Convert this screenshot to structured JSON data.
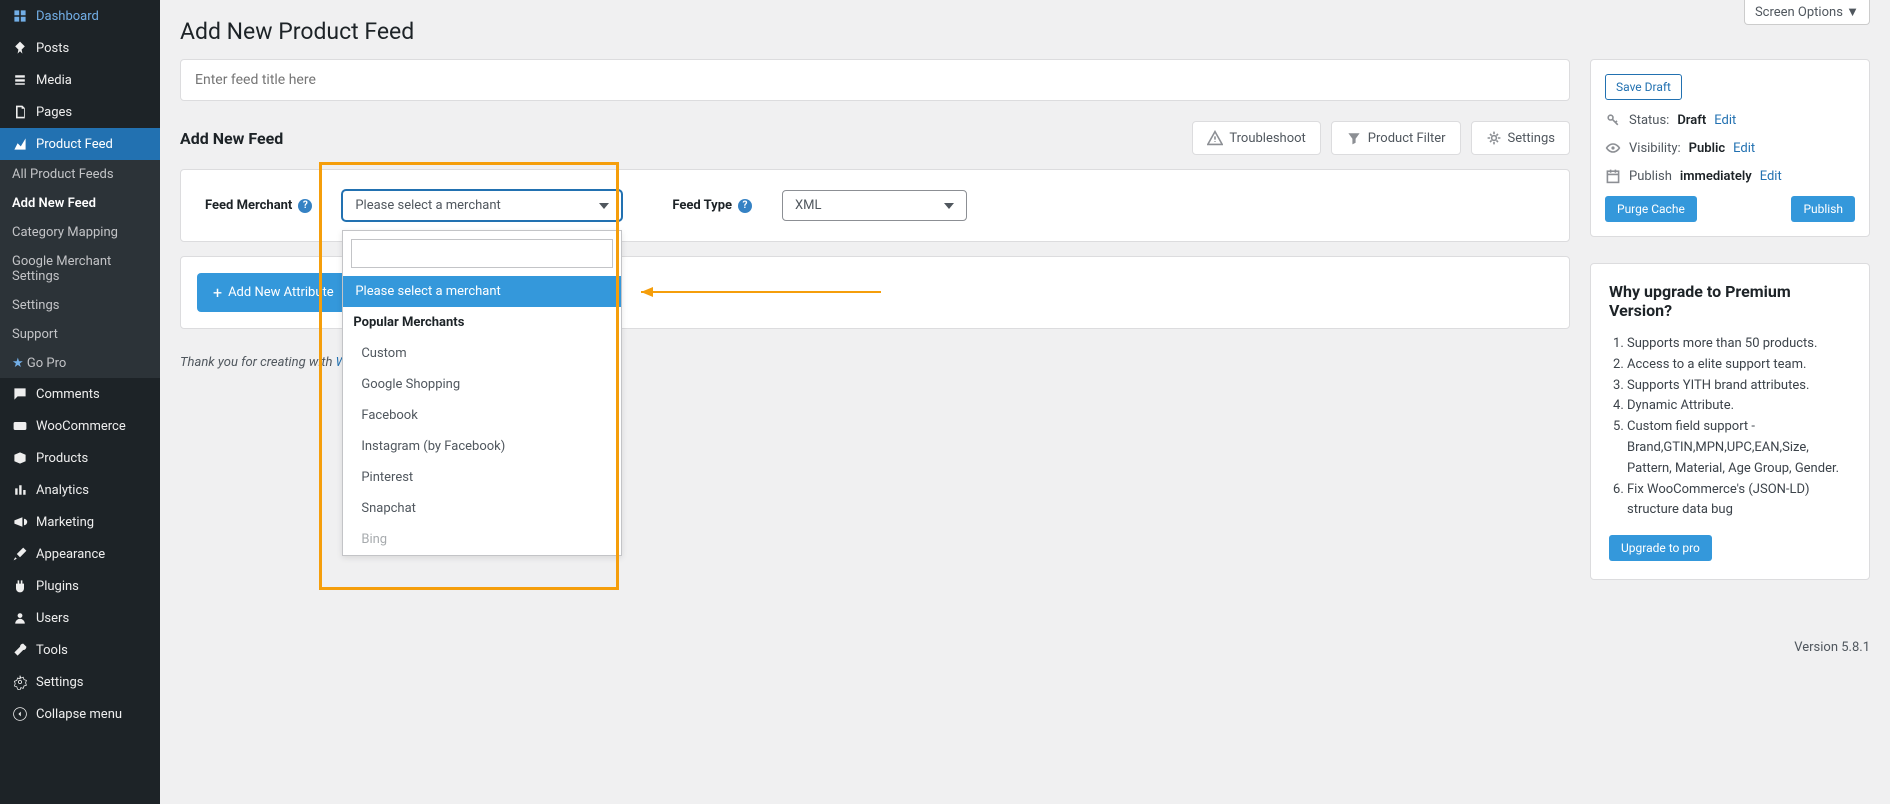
{
  "sidebar": {
    "items": [
      {
        "label": "Dashboard",
        "icon": "dashboard"
      },
      {
        "label": "Posts",
        "icon": "pin"
      },
      {
        "label": "Media",
        "icon": "media"
      },
      {
        "label": "Pages",
        "icon": "pages"
      },
      {
        "label": "Product Feed",
        "icon": "chart"
      },
      {
        "label": "Comments",
        "icon": "comment"
      },
      {
        "label": "WooCommerce",
        "icon": "woo"
      },
      {
        "label": "Products",
        "icon": "box"
      },
      {
        "label": "Analytics",
        "icon": "analytics"
      },
      {
        "label": "Marketing",
        "icon": "megaphone"
      },
      {
        "label": "Appearance",
        "icon": "brush"
      },
      {
        "label": "Plugins",
        "icon": "plug"
      },
      {
        "label": "Users",
        "icon": "users"
      },
      {
        "label": "Tools",
        "icon": "tools"
      },
      {
        "label": "Settings",
        "icon": "settings"
      },
      {
        "label": "Collapse menu",
        "icon": "collapse"
      }
    ],
    "sub_items": [
      "All Product Feeds",
      "Add New Feed",
      "Category Mapping",
      "Google Merchant Settings",
      "Settings",
      "Support",
      "Go Pro"
    ]
  },
  "screen_options": "Screen Options  ▼",
  "page_title": "Add New Product Feed",
  "title_placeholder": "Enter feed title here",
  "section_title": "Add New Feed",
  "header_buttons": {
    "troubleshoot": "Troubleshoot",
    "filter": "Product Filter",
    "settings": "Settings"
  },
  "form": {
    "merchant_label": "Feed Merchant",
    "merchant_placeholder": "Please select a merchant",
    "feed_type_label": "Feed Type",
    "feed_type_value": "XML"
  },
  "dropdown": {
    "selected": "Please select a merchant",
    "group": "Popular Merchants",
    "options": [
      "Custom",
      "Google Shopping",
      "Facebook",
      "Instagram (by Facebook)",
      "Pinterest",
      "Snapchat",
      "Bing"
    ]
  },
  "add_attr_button": "Add New Attribute",
  "publish": {
    "save_draft": "Save Draft",
    "status_label": "Status:",
    "status_value": "Draft",
    "visibility_label": "Visibility:",
    "visibility_value": "Public",
    "publish_label": "Publish",
    "publish_value": "immediately",
    "edit": "Edit",
    "purge_cache": "Purge Cache",
    "publish_btn": "Publish"
  },
  "upgrade": {
    "title": "Why upgrade to Premium Version?",
    "items": [
      "Supports more than 50 products.",
      "Access to a elite support team.",
      "Supports YITH brand attributes.",
      "Dynamic Attribute.",
      "Custom field support - Brand,GTIN,MPN,UPC,EAN,Size, Pattern, Material, Age Group, Gender.",
      "Fix WooCommerce's (JSON-LD) structure data bug"
    ],
    "button": "Upgrade to pro"
  },
  "footer": {
    "text": "Thank you for creating with ",
    "link": "WordPress",
    "version": "Version 5.8.1"
  }
}
